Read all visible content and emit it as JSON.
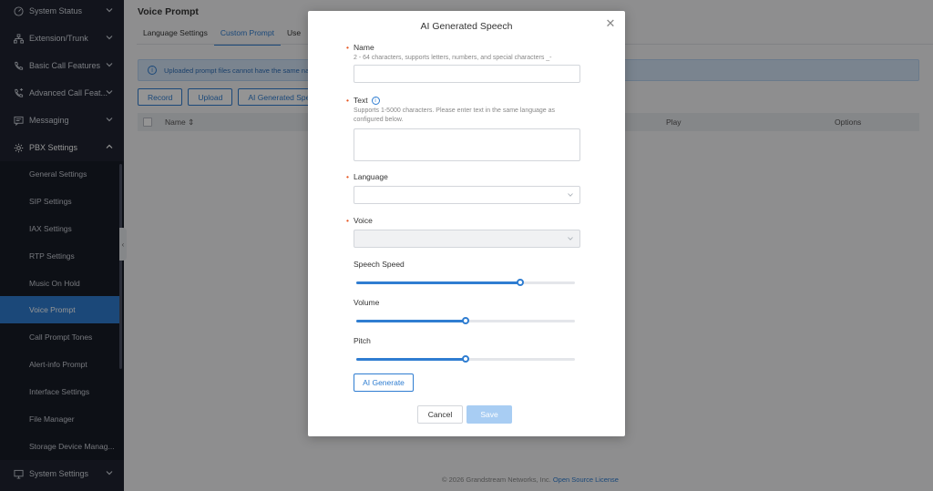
{
  "sidebar": {
    "items": [
      {
        "label": "System Status",
        "icon": "gauge-icon"
      },
      {
        "label": "Extension/Trunk",
        "icon": "network-icon"
      },
      {
        "label": "Basic Call Features",
        "icon": "phone-icon"
      },
      {
        "label": "Advanced Call Feat...",
        "icon": "phone-advanced-icon"
      },
      {
        "label": "Messaging",
        "icon": "message-icon"
      },
      {
        "label": "PBX Settings",
        "icon": "gear-icon"
      }
    ],
    "sub_items": [
      "General Settings",
      "SIP Settings",
      "IAX Settings",
      "RTP Settings",
      "Music On Hold",
      "Voice Prompt",
      "Call Prompt Tones",
      "Alert-info Prompt",
      "Interface Settings",
      "File Manager",
      "Storage Device Manag..."
    ],
    "active_sub_item": "Voice Prompt",
    "bottom_item": {
      "label": "System Settings",
      "icon": "monitor-icon"
    }
  },
  "main": {
    "title": "Voice Prompt",
    "tabs": [
      "Language Settings",
      "Custom Prompt",
      "Use"
    ],
    "active_tab": "Custom Prompt",
    "info_text": "Uploaded prompt files cannot have the same nam",
    "buttons": [
      "Record",
      "Upload",
      "AI Generated Spe"
    ],
    "table_headers": {
      "name": "Name",
      "play": "Play",
      "options": "Options"
    },
    "footer_text": "© 2026 Grandstream Networks, Inc.",
    "footer_link": "Open Source License"
  },
  "modal": {
    "title": "AI Generated Speech",
    "name_label": "Name",
    "name_hint": "2 - 64 characters, supports letters, numbers, and special characters _-",
    "name_value": "",
    "text_label": "Text",
    "text_hint": "Supports 1-5000 characters. Please enter text in the same language as configured below.",
    "text_value": "",
    "language_label": "Language",
    "language_value": "",
    "voice_label": "Voice",
    "voice_value": "",
    "speed_label": "Speech Speed",
    "speed_fraction": 0.75,
    "volume_label": "Volume",
    "volume_fraction": 0.5,
    "pitch_label": "Pitch",
    "pitch_fraction": 0.5,
    "ai_generate_label": "AI Generate",
    "cancel_label": "Cancel",
    "save_label": "Save"
  },
  "colors": {
    "accent": "#2f7dd1",
    "sidebar_bg": "#1f2431",
    "required": "#e6541f"
  }
}
